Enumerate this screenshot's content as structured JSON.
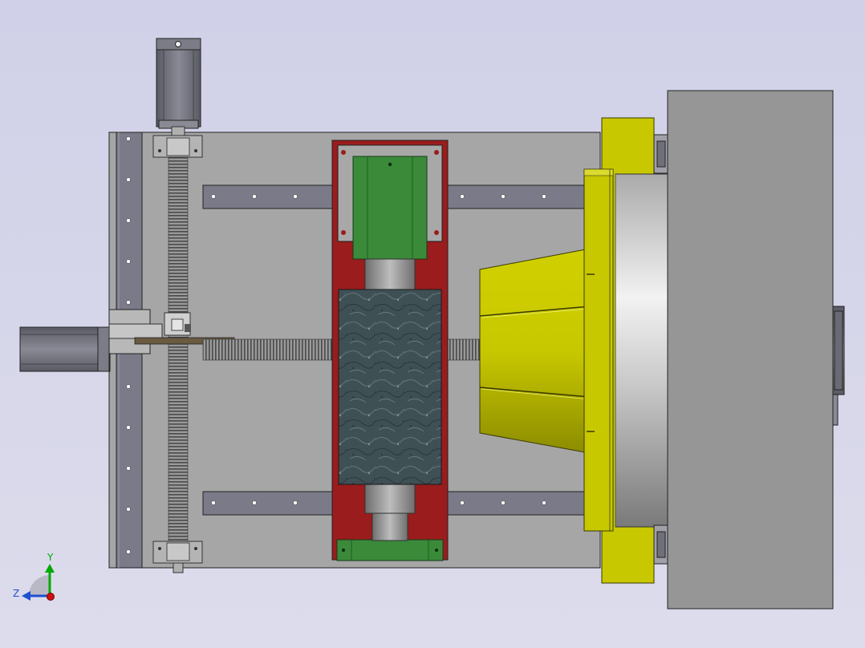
{
  "view": {
    "background_top": "#d0d0e8",
    "background_bottom": "#dcdcec"
  },
  "parts": {
    "base_plate_color": "#a6a6a6",
    "guide_rail_color": "#7a7a88",
    "carriage_color": "#9a1c1c",
    "linear_block_color": "#3a8a3a",
    "grinding_wheel_color": "#3e4f55",
    "cone_collet_color": "#b8b800",
    "flange_color": "#c8c800",
    "headstock_color": "#969696",
    "servo_motor_color": "#6e6e78"
  },
  "triad": {
    "y_label": "Y",
    "z_label": "Z",
    "y_color": "#00aa00",
    "z_color": "#2050d0",
    "x_color": "#d01010"
  }
}
